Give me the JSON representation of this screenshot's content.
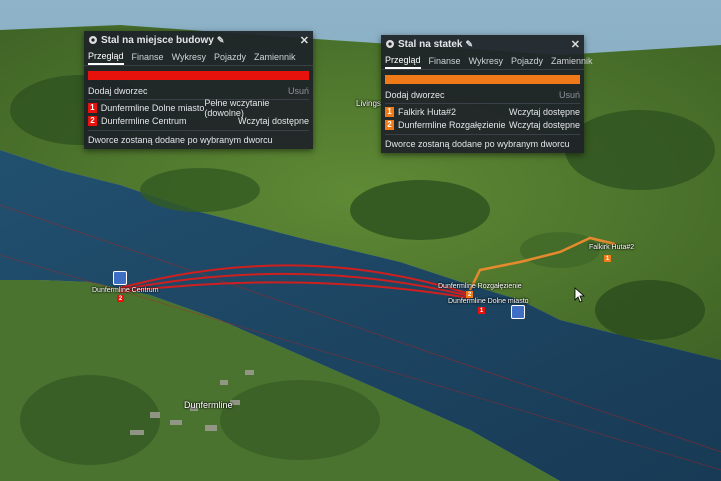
{
  "colors": {
    "water": "#1f4868",
    "land": "#4f7a2e",
    "red_line": "#cf1f1f",
    "orange_line": "#e68a2e",
    "panel_bg": "#1e2228"
  },
  "map": {
    "town_label": "Dunfermline",
    "other_town_label": "Livings",
    "station_labels": {
      "centrum": "Dunfermline Centrum",
      "rozgalezienie": "Dunfermline Rozgałęzienie",
      "dolne": "Dunfermline Dolne miasto",
      "falkirk": "Falkirk Huta#2"
    },
    "markers": {
      "m1": "1",
      "m2": "2"
    }
  },
  "panel_left": {
    "title": "Stal na miejsce budowy",
    "tabs": [
      "Przegląd",
      "Finanse",
      "Wykresy",
      "Pojazdy",
      "Zamiennik"
    ],
    "bar_color": "#e8120c",
    "add_label": "Dodaj dworzec",
    "remove_label": "Usuń",
    "stops": [
      {
        "num": "1",
        "name": "Dunfermline Dolne miasto",
        "load": "Pełne wczytanie (dowolne)"
      },
      {
        "num": "2",
        "name": "Dunfermline Centrum",
        "load": "Wczytaj dostępne"
      }
    ],
    "badge_color": "#e8120c",
    "footer": "Dworce zostaną dodane po wybranym dworcu"
  },
  "panel_right": {
    "title": "Stal na statek",
    "tabs": [
      "Przegląd",
      "Finanse",
      "Wykresy",
      "Pojazdy",
      "Zamiennik"
    ],
    "bar_color": "#f07a17",
    "add_label": "Dodaj dworzec",
    "remove_label": "Usuń",
    "stops": [
      {
        "num": "1",
        "name": "Falkirk Huta#2",
        "load": "Wczytaj dostępne"
      },
      {
        "num": "2",
        "name": "Dunfermline Rozgałęzienie",
        "load": "Wczytaj dostępne"
      }
    ],
    "badge_color": "#f07a17",
    "footer": "Dworce zostaną dodane po wybranym dworcu"
  }
}
